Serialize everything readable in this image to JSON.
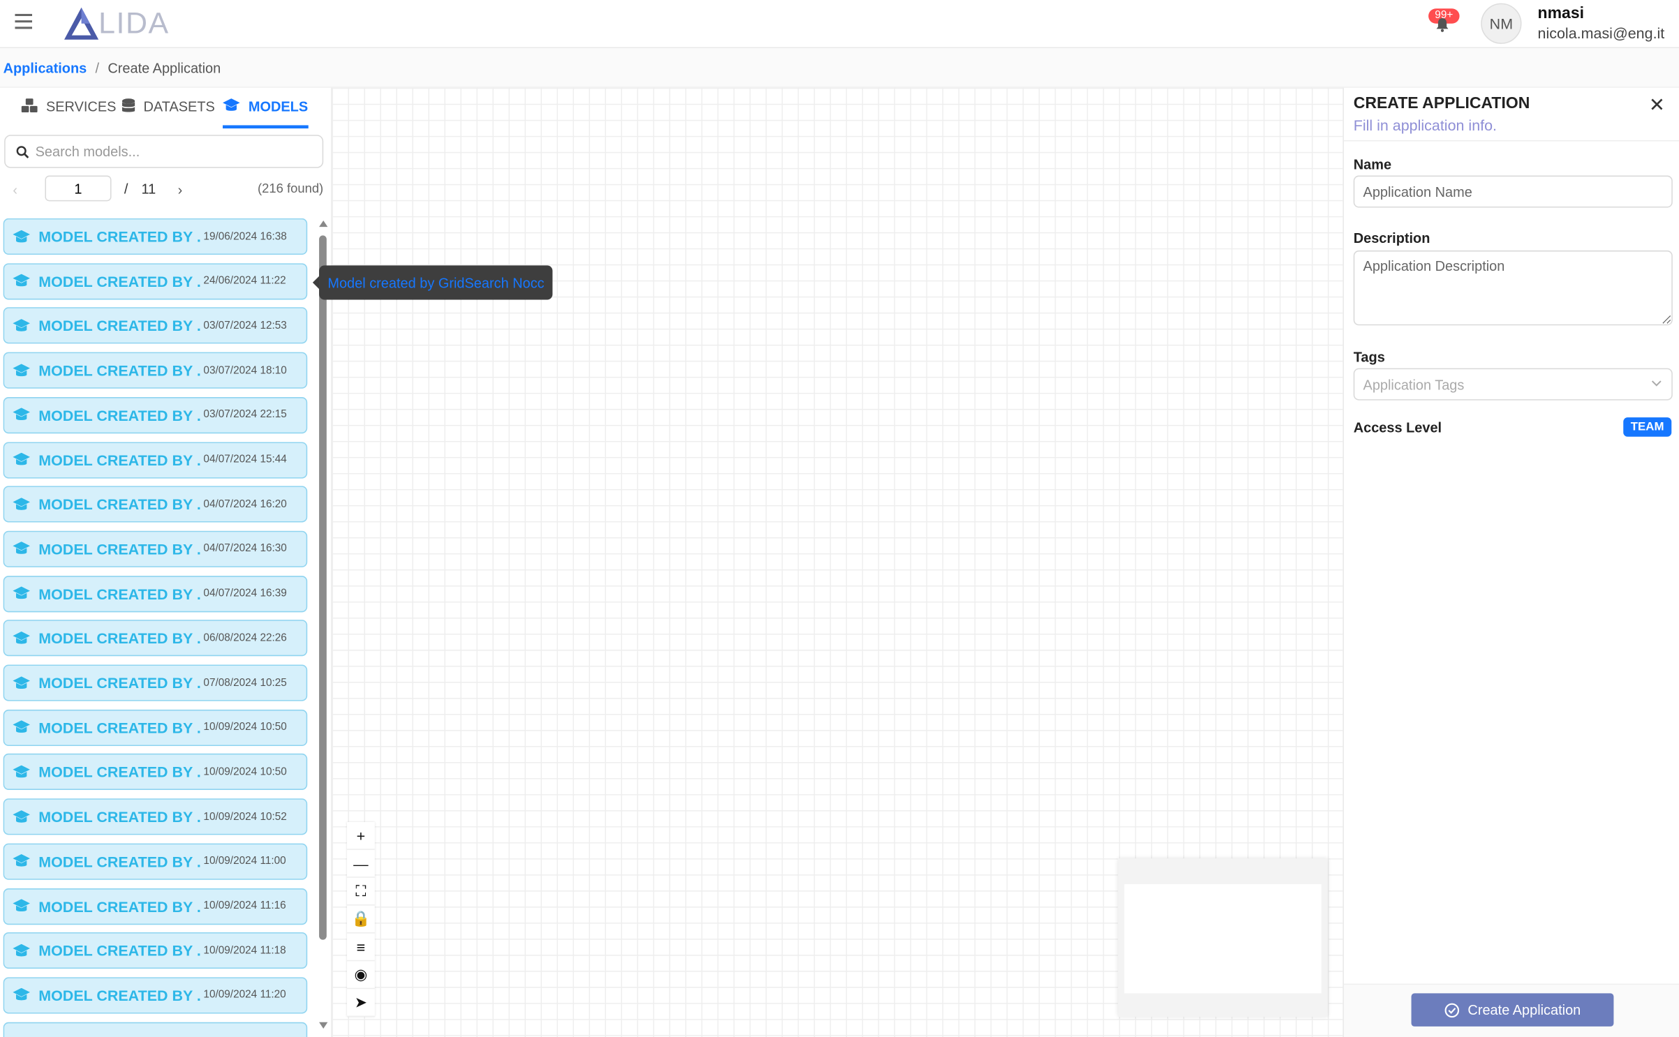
{
  "header": {
    "logo_text": "LIDA",
    "notification_badge": "99+",
    "avatar_initials": "NM",
    "user_name": "nmasi",
    "user_email": "nicola.masi@eng.it"
  },
  "breadcrumb": {
    "root": "Applications",
    "separator": "/",
    "current": "Create Application"
  },
  "sidebar": {
    "tabs": [
      {
        "label": "SERVICES",
        "icon": "cubes-icon",
        "active": false
      },
      {
        "label": "DATASETS",
        "icon": "database-icon",
        "active": false
      },
      {
        "label": "MODELS",
        "icon": "graduation-cap-icon",
        "active": true
      }
    ],
    "search_placeholder": "Search models...",
    "pagination": {
      "current_page": "1",
      "separator": "/",
      "total_pages": "11",
      "found": "(216 found)"
    },
    "items": [
      {
        "title": "MODEL CREATED BY ...",
        "date": "19/06/2024 16:38"
      },
      {
        "title": "MODEL CREATED BY ...",
        "date": "24/06/2024 11:22"
      },
      {
        "title": "MODEL CREATED BY ...",
        "date": "03/07/2024 12:53"
      },
      {
        "title": "MODEL CREATED BY ...",
        "date": "03/07/2024 18:10"
      },
      {
        "title": "MODEL CREATED BY ...",
        "date": "03/07/2024 22:15"
      },
      {
        "title": "MODEL CREATED BY ...",
        "date": "04/07/2024 15:44"
      },
      {
        "title": "MODEL CREATED BY ...",
        "date": "04/07/2024 16:20"
      },
      {
        "title": "MODEL CREATED BY ...",
        "date": "04/07/2024 16:30"
      },
      {
        "title": "MODEL CREATED BY ...",
        "date": "04/07/2024 16:39"
      },
      {
        "title": "MODEL CREATED BY ...",
        "date": "06/08/2024 22:26"
      },
      {
        "title": "MODEL CREATED BY ...",
        "date": "07/08/2024 10:25"
      },
      {
        "title": "MODEL CREATED BY ...",
        "date": "10/09/2024 10:50"
      },
      {
        "title": "MODEL CREATED BY ...",
        "date": "10/09/2024 10:50"
      },
      {
        "title": "MODEL CREATED BY ...",
        "date": "10/09/2024 10:52"
      },
      {
        "title": "MODEL CREATED BY ...",
        "date": "10/09/2024 11:00"
      },
      {
        "title": "MODEL CREATED BY ...",
        "date": "10/09/2024 11:16"
      },
      {
        "title": "MODEL CREATED BY ...",
        "date": "10/09/2024 11:18"
      },
      {
        "title": "MODEL CREATED BY ...",
        "date": "10/09/2024 11:20"
      }
    ],
    "tooltip": "Model created by GridSearch Nocc"
  },
  "canvas": {
    "controls": [
      {
        "icon": "zoom-in-icon",
        "glyph": "+"
      },
      {
        "icon": "zoom-out-icon",
        "glyph": "—"
      },
      {
        "icon": "fit-view-icon",
        "glyph": "⛶"
      },
      {
        "icon": "lock-icon",
        "glyph": "🔒"
      },
      {
        "icon": "menu-icon",
        "glyph": "≡"
      },
      {
        "icon": "hide-icon",
        "glyph": "◉"
      },
      {
        "icon": "locate-icon",
        "glyph": "➤"
      }
    ]
  },
  "panel": {
    "title": "CREATE APPLICATION",
    "subtitle": "Fill in application info.",
    "name_label": "Name",
    "name_placeholder": "Application Name",
    "description_label": "Description",
    "description_placeholder": "Application Description",
    "tags_label": "Tags",
    "tags_placeholder": "Application Tags",
    "access_label": "Access Level",
    "access_value": "TEAM",
    "create_button": "Create Application"
  },
  "colors": {
    "accent": "#1677ff",
    "model_item_bg": "#d6f0fb",
    "model_item_text": "#2db7e8",
    "create_button": "#6c7dbd",
    "badge": "#ff4d4f"
  }
}
